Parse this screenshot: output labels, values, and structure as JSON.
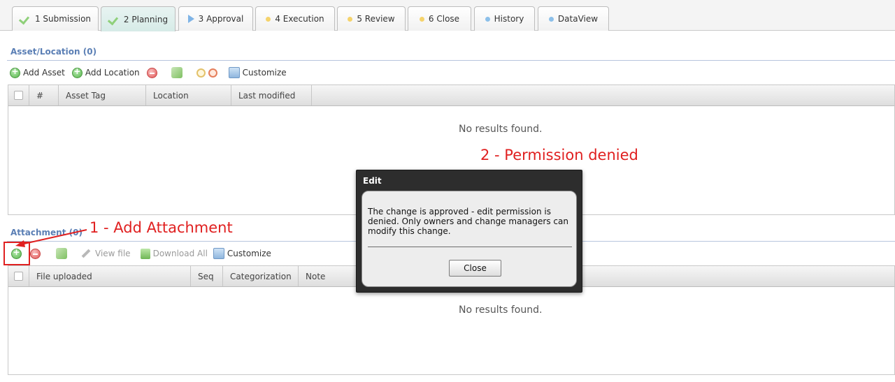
{
  "tabs": [
    {
      "label": "1 Submission",
      "icon": "check-icon",
      "state": "done"
    },
    {
      "label": "2 Planning",
      "icon": "check-icon",
      "state": "active"
    },
    {
      "label": "3 Approval",
      "icon": "play-icon",
      "state": "current"
    },
    {
      "label": "4 Execution",
      "icon": "dot-icon",
      "state": "pending"
    },
    {
      "label": "5 Review",
      "icon": "dot-icon",
      "state": "pending"
    },
    {
      "label": "6 Close",
      "icon": "dot-icon",
      "state": "pending"
    },
    {
      "label": "History",
      "icon": "dot-icon",
      "state": "info"
    },
    {
      "label": "DataView",
      "icon": "dot-icon",
      "state": "info"
    }
  ],
  "colors": {
    "accent_blue": "#5b7fb5",
    "check_green": "#8fd07a",
    "play_blue": "#7fb4e6",
    "pending_dot": "#f5d36b",
    "info_dot": "#8cc0ea",
    "annotation_red": "#e02020"
  },
  "asset_section": {
    "title": "Asset/Location (0)",
    "toolbar": {
      "add_asset": "Add Asset",
      "add_location": "Add Location",
      "customize": "Customize"
    },
    "columns": [
      "#",
      "Asset Tag",
      "Location",
      "Last modified"
    ],
    "empty_text": "No results found."
  },
  "attachment_section": {
    "title": "Attachment (0)",
    "toolbar": {
      "view_file": "View file",
      "download_all": "Download All",
      "customize": "Customize"
    },
    "columns": [
      "File uploaded",
      "Seq",
      "Categorization",
      "Note"
    ],
    "empty_text": "No results found."
  },
  "dialog": {
    "title": "Edit",
    "message": "The change is approved - edit permission is denied. Only owners and change managers can modify this change.",
    "close_label": "Close"
  },
  "annotations": {
    "step1": "1 - Add Attachment",
    "step2": "2 - Permission denied"
  }
}
